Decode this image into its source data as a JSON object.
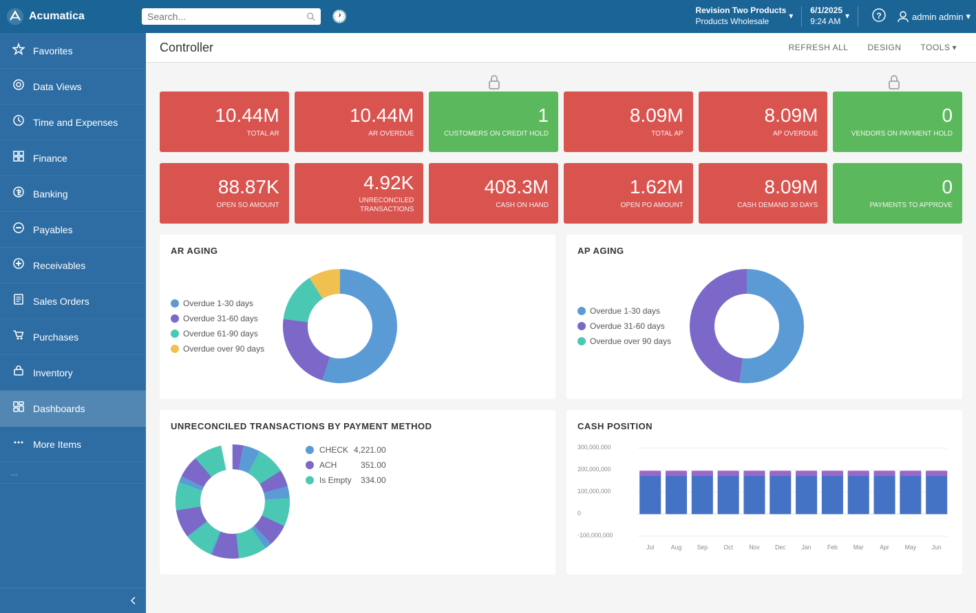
{
  "app": {
    "name": "Acumatica"
  },
  "topnav": {
    "search_placeholder": "Search...",
    "company_name": "Revision Two Products",
    "company_sub": "Products Wholesale",
    "date": "6/1/2025",
    "time": "9:24 AM",
    "user": "admin admin",
    "history_icon": "🕐"
  },
  "sidebar": {
    "items": [
      {
        "id": "favorites",
        "label": "Favorites",
        "icon": "☆"
      },
      {
        "id": "data-views",
        "label": "Data Views",
        "icon": "⊙"
      },
      {
        "id": "time-expenses",
        "label": "Time and Expenses",
        "icon": "🕐"
      },
      {
        "id": "finance",
        "label": "Finance",
        "icon": "⊞"
      },
      {
        "id": "banking",
        "label": "Banking",
        "icon": "$"
      },
      {
        "id": "payables",
        "label": "Payables",
        "icon": "⊖"
      },
      {
        "id": "receivables",
        "label": "Receivables",
        "icon": "⊕"
      },
      {
        "id": "sales-orders",
        "label": "Sales Orders",
        "icon": "✏"
      },
      {
        "id": "purchases",
        "label": "Purchases",
        "icon": "🛒"
      },
      {
        "id": "inventory",
        "label": "Inventory",
        "icon": "📦"
      },
      {
        "id": "dashboards",
        "label": "Dashboards",
        "icon": "⊙",
        "active": true
      },
      {
        "id": "more-items",
        "label": "More Items",
        "icon": "⋯"
      }
    ]
  },
  "page": {
    "title": "Controller",
    "actions": {
      "refresh_all": "REFRESH ALL",
      "design": "DESIGN",
      "tools": "TOOLS"
    }
  },
  "kpi_row1": [
    {
      "id": "total-ar",
      "value": "10.44M",
      "label": "TOTAL AR",
      "color": "red"
    },
    {
      "id": "ar-overdue",
      "value": "10.44M",
      "label": "AR OVERDUE",
      "color": "red"
    },
    {
      "id": "customers-credit-hold",
      "value": "1",
      "label": "CUSTOMERS ON CREDIT HOLD",
      "color": "green"
    },
    {
      "id": "total-ap",
      "value": "8.09M",
      "label": "TOTAL AP",
      "color": "red"
    },
    {
      "id": "ap-overdue",
      "value": "8.09M",
      "label": "AP OVERDUE",
      "color": "red"
    },
    {
      "id": "vendors-payment-hold",
      "value": "0",
      "label": "VENDORS ON PAYMENT HOLD",
      "color": "green"
    }
  ],
  "kpi_row2": [
    {
      "id": "open-so-amount",
      "value": "88.87K",
      "label": "OPEN SO AMOUNT",
      "color": "red"
    },
    {
      "id": "unreconciled-transactions",
      "value": "4.92K",
      "label": "UNRECONCILED TRANSACTIONS",
      "color": "red"
    },
    {
      "id": "cash-on-hand",
      "value": "408.3M",
      "label": "CASH ON HAND",
      "color": "red"
    },
    {
      "id": "open-po-amount",
      "value": "1.62M",
      "label": "OPEN PO AMOUNT",
      "color": "red"
    },
    {
      "id": "cash-demand-30",
      "value": "8.09M",
      "label": "CASH DEMAND 30 DAYS",
      "color": "red"
    },
    {
      "id": "payments-to-approve",
      "value": "0",
      "label": "PAYMENTS TO APPROVE",
      "color": "green"
    }
  ],
  "ar_aging": {
    "title": "AR AGING",
    "legend": [
      {
        "label": "Overdue 1-30 days",
        "color": "#5b9bd5"
      },
      {
        "label": "Overdue 31-60 days",
        "color": "#7b68c8"
      },
      {
        "label": "Overdue 61-90 days",
        "color": "#4bc8b4"
      },
      {
        "label": "Overdue over 90 days",
        "color": "#f0c050"
      }
    ],
    "segments": [
      {
        "color": "#5b9bd5",
        "pct": 55
      },
      {
        "color": "#7b68c8",
        "pct": 22
      },
      {
        "color": "#4bc8b4",
        "pct": 14
      },
      {
        "color": "#f0c050",
        "pct": 9
      }
    ]
  },
  "ap_aging": {
    "title": "AP AGING",
    "legend": [
      {
        "label": "Overdue 1-30 days",
        "color": "#5b9bd5"
      },
      {
        "label": "Overdue 31-60 days",
        "color": "#7b68c8"
      },
      {
        "label": "Overdue over 90 days",
        "color": "#4bc8b4"
      }
    ],
    "segments": [
      {
        "color": "#5b9bd5",
        "pct": 52
      },
      {
        "color": "#7b68c8",
        "pct": 48
      }
    ]
  },
  "unreconciled": {
    "title": "UNRECONCILED TRANSACTIONS BY PAYMENT METHOD",
    "legend": [
      {
        "label": "CHECK",
        "value": "4,221.00",
        "color": "#5b9bd5"
      },
      {
        "label": "ACH",
        "value": "351.00",
        "color": "#7b68c8"
      },
      {
        "label": "Is Empty",
        "value": "334.00",
        "color": "#4bc8b4"
      }
    ]
  },
  "cash_position": {
    "title": "CASH POSITION",
    "y_labels": [
      "300,000,000",
      "200,000,000",
      "100,000,000",
      "0",
      "-100,000,000"
    ],
    "x_labels": [
      "Jul",
      "Aug",
      "Sep",
      "Oct",
      "Nov",
      "Dec",
      "Jan",
      "Feb",
      "Mar",
      "Apr",
      "May",
      "Jun"
    ]
  }
}
